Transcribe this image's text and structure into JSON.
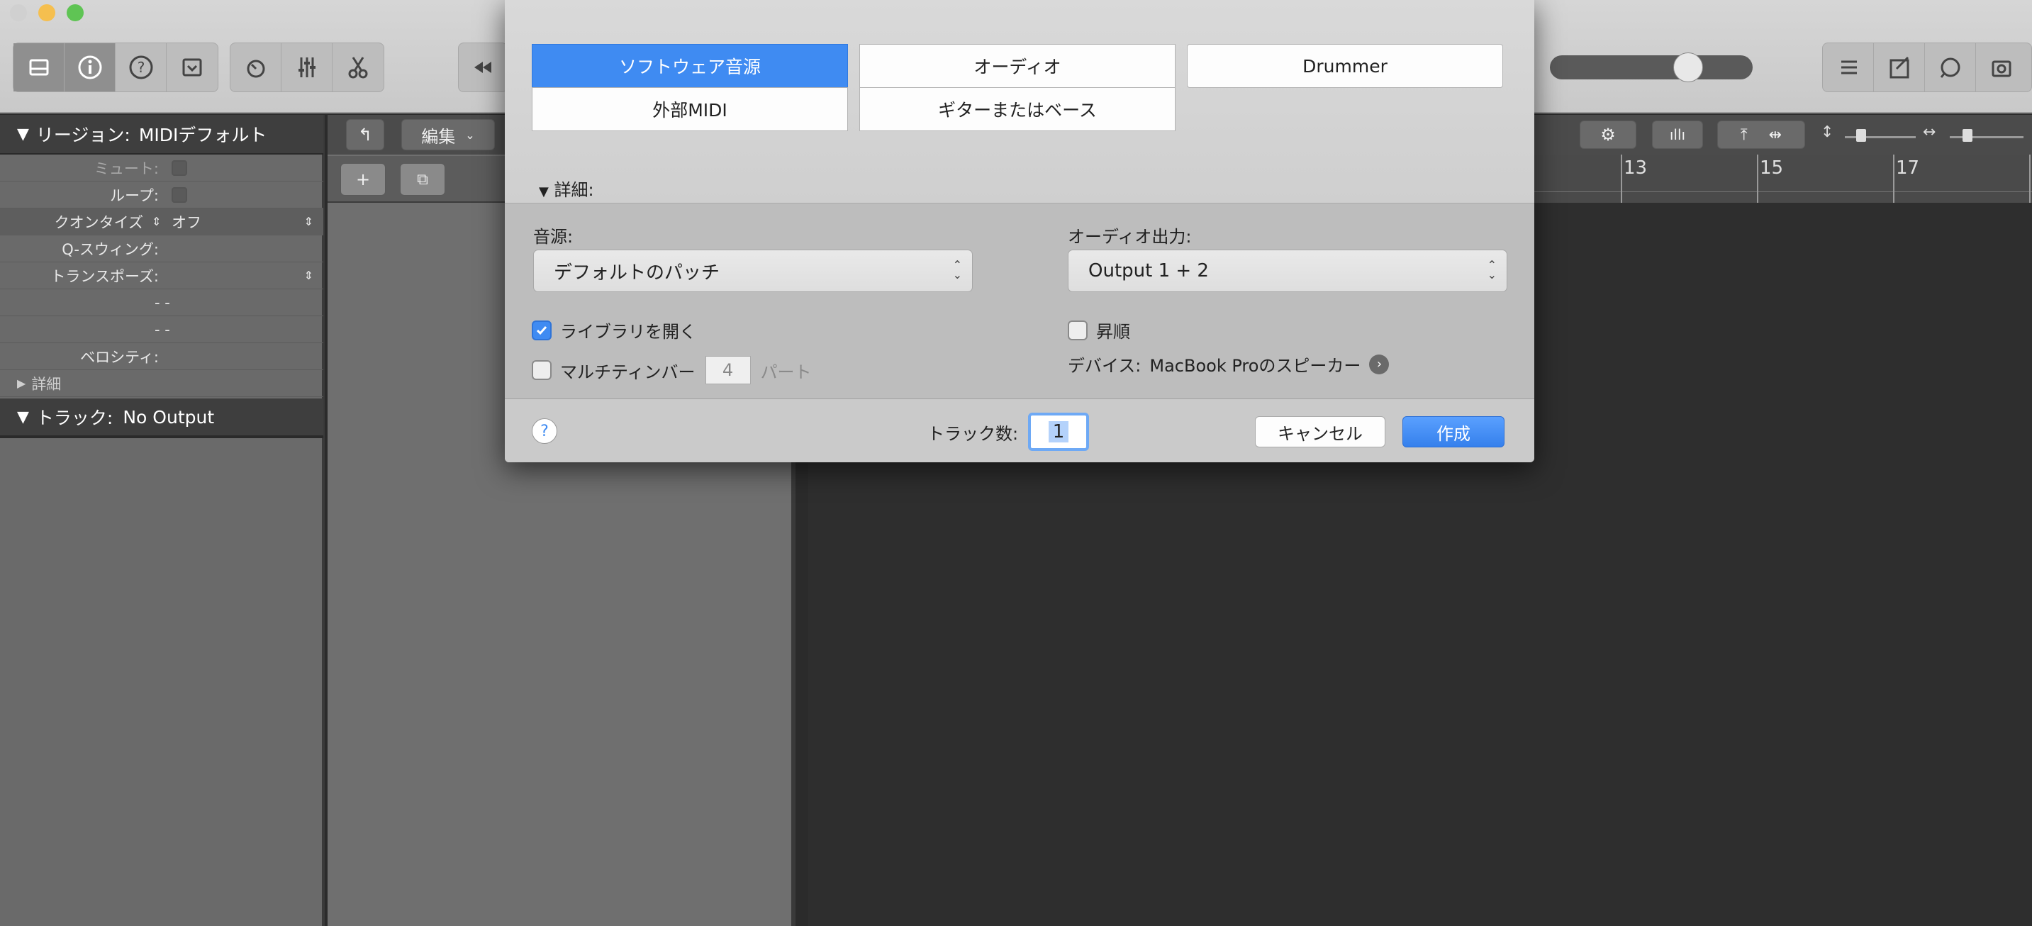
{
  "dialog": {
    "types": [
      {
        "label": "ソフトウェア音源",
        "selected": true
      },
      {
        "label": "オーディオ",
        "selected": false
      },
      {
        "label": "Drummer",
        "selected": false
      },
      {
        "label": "外部MIDI",
        "selected": false
      },
      {
        "label": "ギターまたはベース",
        "selected": false
      }
    ],
    "details_label": "詳細:",
    "source": {
      "label": "音源:",
      "value": "デフォルトのパッチ"
    },
    "audio_output": {
      "label": "オーディオ出力:",
      "value": "Output 1 + 2"
    },
    "open_library": {
      "label": "ライブラリを開く",
      "checked": true
    },
    "ascending": {
      "label": "昇順",
      "checked": false
    },
    "multitimbral": {
      "label": "マルチティンバー",
      "checked": false,
      "parts_value": "4",
      "parts_label": "パート"
    },
    "device": {
      "label": "デバイス:",
      "value": "MacBook Proのスピーカー"
    },
    "help_label": "?",
    "track_count": {
      "label": "トラック数:",
      "value": "1"
    },
    "cancel_label": "キャンセル",
    "create_label": "作成"
  },
  "inspector": {
    "region_header": {
      "label": "リージョン:",
      "value": "MIDIデフォルト"
    },
    "rows": [
      {
        "label": "ミュート:",
        "value": ""
      },
      {
        "label": "ループ:",
        "value": ""
      },
      {
        "label": "クオンタイズ",
        "value": "オフ"
      },
      {
        "label": "Q-スウィング:",
        "value": ""
      },
      {
        "label": "トランスポーズ:",
        "value": ""
      },
      {
        "label": "",
        "value": "- -"
      },
      {
        "label": "",
        "value": "- -"
      },
      {
        "label": "ベロシティ:",
        "value": ""
      }
    ],
    "details_label": "詳細",
    "track_header": {
      "label": "トラック:",
      "value": "No Output"
    }
  },
  "tracks_header": {
    "edit_label": "編集"
  },
  "ruler": {
    "marks": [
      "13",
      "15",
      "17"
    ]
  },
  "colors": {
    "accent": "#3f8bf2",
    "dialog_bg": "#d2d2d2",
    "inspector_bg": "#6a6a6a"
  }
}
